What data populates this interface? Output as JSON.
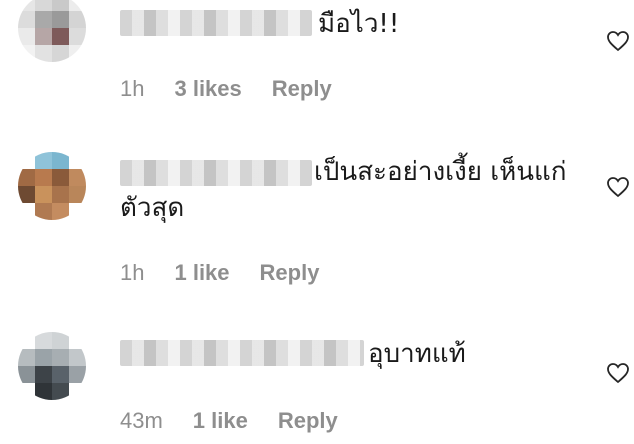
{
  "comments": [
    {
      "text": "มือไว!!",
      "time": "1h",
      "likes": "3 likes",
      "reply": "Reply",
      "like_icon": "heart-outline-icon",
      "avatar_colors": [
        "#e6e6e6",
        "#d8d8d8",
        "#c9c9c9",
        "#ececec",
        "#dcdcdc",
        "#a9a9a9",
        "#9a9a9a",
        "#d4d4d4",
        "#eaeaea",
        "#b6a6a6",
        "#7e5a5a",
        "#dcdcdc",
        "#f2f2f2",
        "#e2e2e2",
        "#d6d6d6",
        "#efefef"
      ]
    },
    {
      "text": "เป็นสะอย่างเงี้ย เห็นแก่ตัวสุด",
      "time": "1h",
      "likes": "1 like",
      "reply": "Reply",
      "like_icon": "heart-outline-icon",
      "avatar_colors": [
        "#ffffff",
        "#8fc3d9",
        "#7bb6cf",
        "#ffffff",
        "#a06a44",
        "#b87a4e",
        "#8a5a3a",
        "#c08a5e",
        "#6e4a32",
        "#c9925c",
        "#a8734c",
        "#b9865a",
        "#ffffff",
        "#b07a52",
        "#c48c60",
        "#ffffff"
      ]
    },
    {
      "text": "อุบาทแท้",
      "time": "43m",
      "likes": "1 like",
      "reply": "Reply",
      "like_icon": "heart-outline-icon",
      "avatar_colors": [
        "#ffffff",
        "#d7dadc",
        "#cfd3d5",
        "#ffffff",
        "#b6bcbf",
        "#9aa3a8",
        "#a7aeb2",
        "#c2c7ca",
        "#8a9297",
        "#3d4348",
        "#59626a",
        "#9aa1a6",
        "#ffffff",
        "#2f3438",
        "#444b50",
        "#ffffff"
      ]
    }
  ]
}
